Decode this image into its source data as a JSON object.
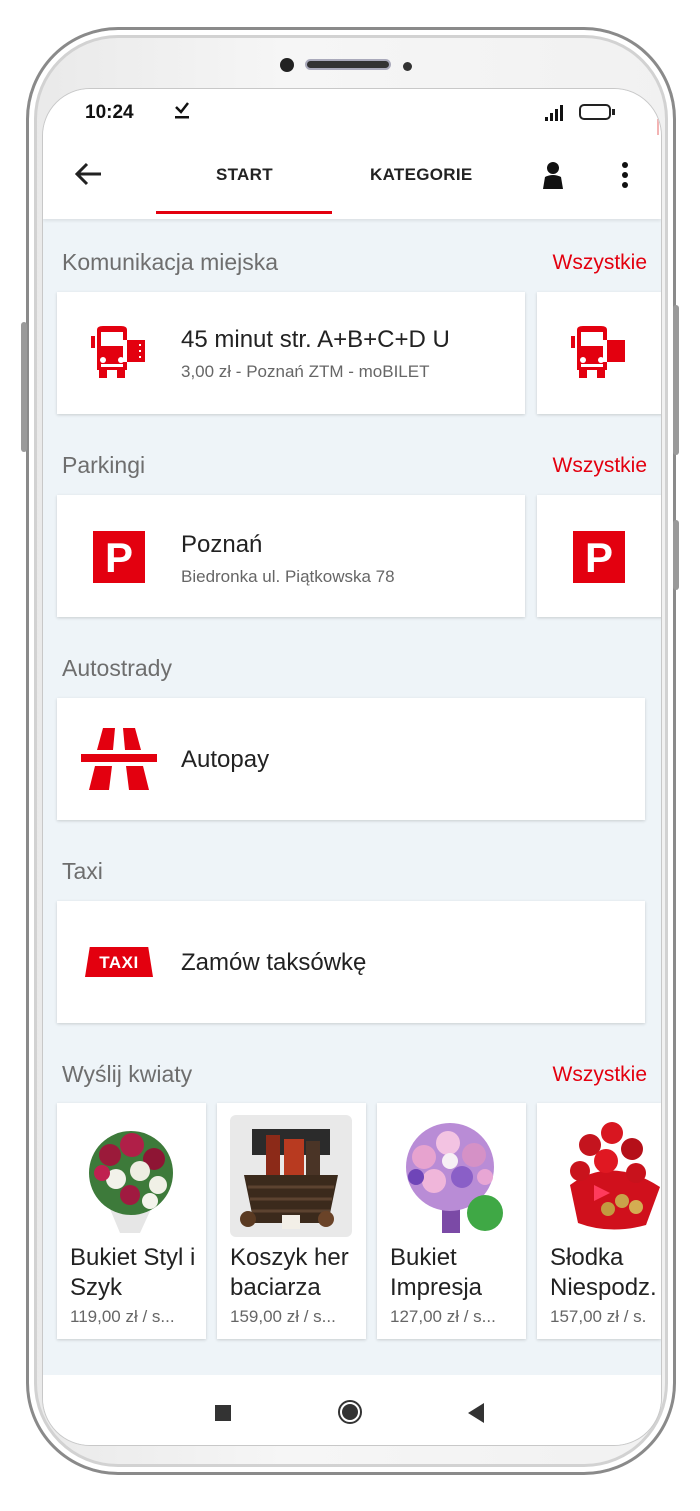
{
  "status": {
    "time": "10:24",
    "download_icon": "download-done-icon"
  },
  "toolbar": {
    "tabs": [
      {
        "label": "START",
        "active": true
      },
      {
        "label": "KATEGORIE",
        "active": false
      }
    ],
    "accent": "#e3000f"
  },
  "sections": {
    "transport": {
      "title": "Komunikacja miejska",
      "all": "Wszystkie",
      "card": {
        "title": "45 minut str. A+B+C+D U",
        "subtitle": "3,00 zł - Poznań ZTM - moBILET",
        "icon": "bus-ticket-icon"
      }
    },
    "parking": {
      "title": "Parkingi",
      "all": "Wszystkie",
      "card": {
        "title": "Poznań",
        "subtitle": "Biedronka ul. Piątkowska 78",
        "icon_letter": "P"
      }
    },
    "highways": {
      "title": "Autostrady",
      "card": {
        "title": "Autopay",
        "icon": "highway-icon"
      }
    },
    "taxi": {
      "title": "Taxi",
      "card": {
        "title": "Zamów taksówkę",
        "badge": "TAXI"
      }
    },
    "flowers": {
      "title": "Wyślij kwiaty",
      "all": "Wszystkie",
      "items": [
        {
          "name": "Bukiet Styl i Szyk",
          "price": "119,00 zł / s..."
        },
        {
          "name": "Koszyk her baciarza",
          "price": "159,00 zł / s..."
        },
        {
          "name": "Bukiet Impresja",
          "price": "127,00 zł / s..."
        },
        {
          "name": "Słodka Niespodz.",
          "price": "157,00 zł / s."
        }
      ]
    }
  }
}
